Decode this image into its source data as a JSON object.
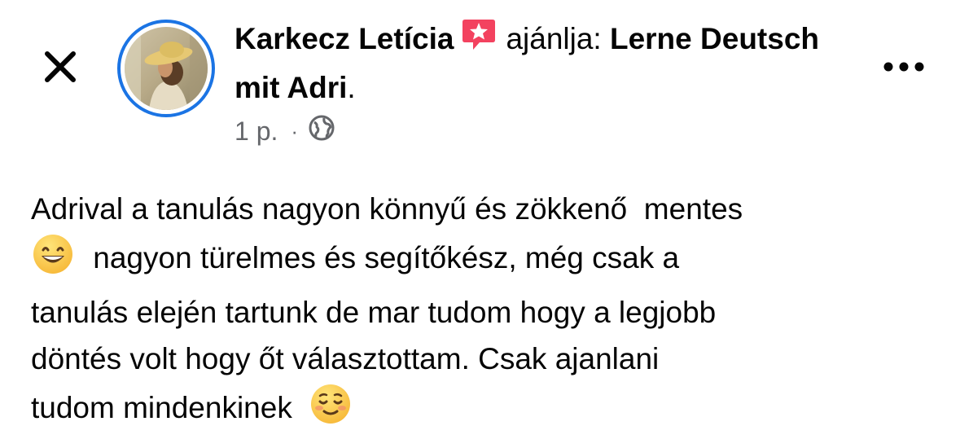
{
  "post": {
    "author_name": "Karkecz Letícia",
    "recommends_label": "ajánlja:",
    "page_name": "Lerne Deutsch mit Adri",
    "period": ".",
    "timestamp": "1 p.",
    "separator": "·",
    "audience_icon": "globe-icon",
    "badge_icon": "recommend-star-icon",
    "accent_color": "#1b74e4",
    "badge_color": "#f3425f",
    "body_line1": "Adrival a tanulás nagyon könnyű és zökkenő  mentes",
    "body_line2": "nagyon türelmes és segítőkész, még csak a",
    "body_line3": "tanulás elején tartunk de mar tudom hogy a legjobb",
    "body_line4": "döntés volt hogy őt választottam. Csak ajanlani",
    "body_line5": "tudom mindenkinek",
    "emoji_1": "grinning-face-emoji",
    "emoji_2": "smiling-face-emoji"
  },
  "toolbar": {
    "close_icon": "close-icon",
    "more_icon": "more-options-icon"
  }
}
